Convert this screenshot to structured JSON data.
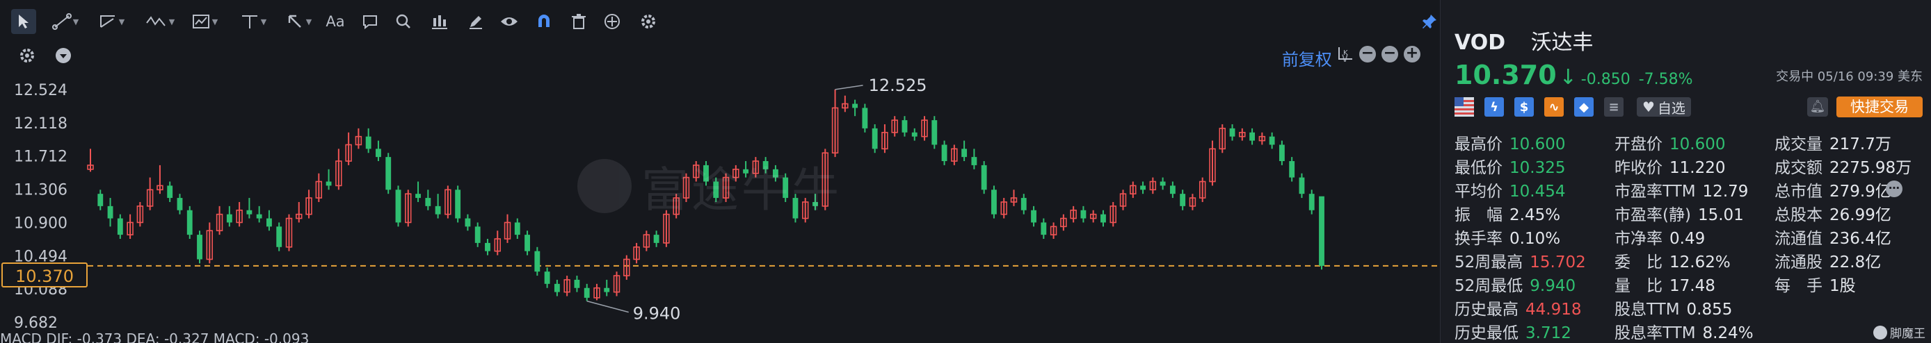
{
  "chart": {
    "adjust_label": "前复权",
    "watermark": "富途牛牛",
    "y_ticks": [
      "12.524",
      "12.118",
      "11.712",
      "11.306",
      "10.900",
      "10.494",
      "10.088",
      "9.682"
    ],
    "current_price_label": "10.370",
    "high_label": "12.525",
    "low_label": "9.940",
    "indicator_text": "MACD  DIF: -0.373  DEA: -0.327  MACD: -0.093",
    "colors": {
      "up": "#f05454",
      "down": "#2fbf71",
      "bg": "#16181d",
      "price_line": "#e8a33a",
      "accent": "#4d8ff7"
    }
  },
  "chart_data": {
    "type": "candlestick",
    "y_axis": {
      "min": 9.682,
      "max": 12.524,
      "ticks": [
        12.524,
        12.118,
        11.712,
        11.306,
        10.9,
        10.494,
        10.088,
        9.682
      ]
    },
    "current_price": 10.37,
    "annotations": [
      {
        "label": "12.525",
        "value": 12.525
      },
      {
        "label": "9.940",
        "value": 9.94
      }
    ],
    "candles": [
      [
        11.55,
        11.6,
        11.52,
        11.8
      ],
      [
        11.25,
        11.1,
        11.05,
        11.3
      ],
      [
        11.1,
        10.95,
        10.85,
        11.2
      ],
      [
        10.95,
        10.75,
        10.7,
        11.0
      ],
      [
        10.75,
        10.9,
        10.7,
        11.0
      ],
      [
        10.9,
        11.1,
        10.85,
        11.15
      ],
      [
        11.1,
        11.3,
        11.05,
        11.45
      ],
      [
        11.3,
        11.35,
        11.25,
        11.6
      ],
      [
        11.35,
        11.2,
        11.15,
        11.4
      ],
      [
        11.2,
        11.05,
        11.0,
        11.25
      ],
      [
        11.05,
        10.75,
        10.7,
        11.1
      ],
      [
        10.75,
        10.45,
        10.4,
        10.8
      ],
      [
        10.45,
        10.8,
        10.4,
        10.9
      ],
      [
        10.8,
        11.0,
        10.75,
        11.1
      ],
      [
        11.0,
        10.9,
        10.85,
        11.1
      ],
      [
        10.9,
        11.05,
        10.85,
        11.15
      ],
      [
        11.05,
        11.0,
        10.95,
        11.2
      ],
      [
        11.0,
        10.95,
        10.9,
        11.1
      ],
      [
        10.95,
        10.85,
        10.8,
        11.05
      ],
      [
        10.85,
        10.6,
        10.55,
        10.9
      ],
      [
        10.6,
        10.95,
        10.55,
        11.0
      ],
      [
        10.95,
        11.0,
        10.9,
        11.15
      ],
      [
        11.0,
        11.2,
        10.95,
        11.3
      ],
      [
        11.2,
        11.4,
        11.15,
        11.5
      ],
      [
        11.4,
        11.35,
        11.3,
        11.55
      ],
      [
        11.35,
        11.65,
        11.3,
        11.8
      ],
      [
        11.65,
        11.85,
        11.6,
        12.0
      ],
      [
        11.85,
        11.95,
        11.8,
        12.05
      ],
      [
        11.95,
        11.8,
        11.75,
        12.05
      ],
      [
        11.8,
        11.7,
        11.65,
        11.9
      ],
      [
        11.7,
        11.3,
        11.25,
        11.75
      ],
      [
        11.3,
        10.9,
        10.85,
        11.35
      ],
      [
        10.9,
        11.25,
        10.85,
        11.3
      ],
      [
        11.25,
        11.2,
        11.15,
        11.4
      ],
      [
        11.2,
        11.1,
        11.05,
        11.3
      ],
      [
        11.1,
        11.0,
        10.95,
        11.25
      ],
      [
        11.0,
        11.3,
        10.95,
        11.35
      ],
      [
        11.3,
        10.95,
        10.9,
        11.35
      ],
      [
        10.95,
        10.85,
        10.8,
        11.0
      ],
      [
        10.85,
        10.65,
        10.6,
        10.9
      ],
      [
        10.65,
        10.55,
        10.5,
        10.7
      ],
      [
        10.55,
        10.7,
        10.5,
        10.8
      ],
      [
        10.7,
        10.9,
        10.65,
        11.0
      ],
      [
        10.9,
        10.75,
        10.7,
        10.95
      ],
      [
        10.75,
        10.55,
        10.5,
        10.8
      ],
      [
        10.55,
        10.3,
        10.25,
        10.6
      ],
      [
        10.3,
        10.15,
        10.1,
        10.35
      ],
      [
        10.15,
        10.05,
        10.0,
        10.2
      ],
      [
        10.05,
        10.2,
        10.0,
        10.25
      ],
      [
        10.2,
        10.1,
        10.05,
        10.25
      ],
      [
        10.1,
        9.98,
        9.94,
        10.15
      ],
      [
        9.98,
        10.1,
        9.95,
        10.15
      ],
      [
        10.1,
        10.05,
        10.0,
        10.2
      ],
      [
        10.05,
        10.25,
        10.0,
        10.3
      ],
      [
        10.25,
        10.45,
        10.2,
        10.5
      ],
      [
        10.45,
        10.6,
        10.4,
        10.65
      ],
      [
        10.6,
        10.75,
        10.55,
        10.8
      ],
      [
        10.75,
        10.65,
        10.6,
        10.8
      ],
      [
        10.65,
        11.0,
        10.6,
        11.05
      ],
      [
        11.0,
        11.2,
        10.95,
        11.25
      ],
      [
        11.2,
        11.45,
        11.15,
        11.5
      ],
      [
        11.45,
        11.6,
        11.4,
        11.65
      ],
      [
        11.6,
        11.4,
        11.35,
        11.65
      ],
      [
        11.4,
        11.2,
        11.15,
        11.45
      ],
      [
        11.2,
        11.45,
        11.15,
        11.5
      ],
      [
        11.45,
        11.55,
        11.4,
        11.6
      ],
      [
        11.55,
        11.5,
        11.45,
        11.65
      ],
      [
        11.5,
        11.65,
        11.45,
        11.7
      ],
      [
        11.65,
        11.55,
        11.5,
        11.7
      ],
      [
        11.55,
        11.45,
        11.4,
        11.6
      ],
      [
        11.45,
        11.2,
        11.15,
        11.5
      ],
      [
        11.2,
        10.95,
        10.9,
        11.25
      ],
      [
        10.95,
        11.15,
        10.9,
        11.2
      ],
      [
        11.15,
        11.1,
        11.05,
        11.25
      ],
      [
        11.1,
        11.75,
        11.05,
        11.8
      ],
      [
        11.75,
        12.3,
        11.7,
        12.525
      ],
      [
        12.3,
        12.35,
        12.25,
        12.45
      ],
      [
        12.35,
        12.3,
        12.2,
        12.4
      ],
      [
        12.3,
        12.05,
        12.0,
        12.35
      ],
      [
        12.05,
        11.8,
        11.75,
        12.1
      ],
      [
        11.8,
        12.0,
        11.75,
        12.1
      ],
      [
        12.0,
        12.15,
        11.95,
        12.2
      ],
      [
        12.15,
        12.0,
        11.95,
        12.2
      ],
      [
        12.0,
        11.95,
        11.9,
        12.05
      ],
      [
        11.95,
        12.15,
        11.9,
        12.2
      ],
      [
        12.15,
        11.85,
        11.8,
        12.2
      ],
      [
        11.85,
        11.65,
        11.6,
        11.9
      ],
      [
        11.65,
        11.8,
        11.6,
        11.85
      ],
      [
        11.8,
        11.7,
        11.65,
        11.9
      ],
      [
        11.7,
        11.6,
        11.55,
        11.8
      ],
      [
        11.6,
        11.3,
        11.25,
        11.65
      ],
      [
        11.3,
        11.0,
        10.95,
        11.35
      ],
      [
        11.0,
        11.15,
        10.95,
        11.2
      ],
      [
        11.15,
        11.2,
        11.1,
        11.3
      ],
      [
        11.2,
        11.05,
        11.0,
        11.25
      ],
      [
        11.05,
        10.9,
        10.85,
        11.1
      ],
      [
        10.9,
        10.75,
        10.7,
        10.95
      ],
      [
        10.75,
        10.85,
        10.7,
        10.9
      ],
      [
        10.85,
        10.95,
        10.8,
        11.0
      ],
      [
        10.95,
        11.05,
        10.9,
        11.1
      ],
      [
        11.05,
        10.95,
        10.9,
        11.1
      ],
      [
        10.95,
        11.0,
        10.9,
        11.05
      ],
      [
        11.0,
        10.9,
        10.85,
        11.05
      ],
      [
        10.9,
        11.1,
        10.85,
        11.15
      ],
      [
        11.1,
        11.25,
        11.05,
        11.3
      ],
      [
        11.25,
        11.35,
        11.2,
        11.4
      ],
      [
        11.35,
        11.3,
        11.25,
        11.4
      ],
      [
        11.3,
        11.4,
        11.25,
        11.45
      ],
      [
        11.4,
        11.35,
        11.3,
        11.45
      ],
      [
        11.35,
        11.25,
        11.2,
        11.4
      ],
      [
        11.25,
        11.1,
        11.05,
        11.3
      ],
      [
        11.1,
        11.2,
        11.05,
        11.25
      ],
      [
        11.2,
        11.4,
        11.15,
        11.45
      ],
      [
        11.4,
        11.8,
        11.35,
        11.9
      ],
      [
        11.8,
        12.05,
        11.75,
        12.1
      ],
      [
        12.05,
        11.95,
        11.9,
        12.1
      ],
      [
        11.95,
        12.0,
        11.9,
        12.05
      ],
      [
        12.0,
        11.9,
        11.85,
        12.05
      ],
      [
        11.9,
        11.95,
        11.85,
        12.0
      ],
      [
        11.95,
        11.85,
        11.8,
        12.0
      ],
      [
        11.85,
        11.65,
        11.6,
        11.9
      ],
      [
        11.65,
        11.45,
        11.4,
        11.7
      ],
      [
        11.45,
        11.25,
        11.2,
        11.5
      ],
      [
        11.25,
        11.05,
        11.0,
        11.3
      ],
      [
        11.22,
        10.37,
        10.325,
        10.6
      ]
    ]
  },
  "quote": {
    "symbol": "VOD",
    "name": "沃达丰",
    "price": "10.370",
    "arrow": "↓",
    "change": "-0.850",
    "change_pct": "-7.58%",
    "status": "交易中 05/16 09:39 美东",
    "watchlist_label": "自选",
    "trade_label": "快捷交易",
    "stats": [
      {
        "label": "最高价",
        "value": "10.600",
        "tone": "down"
      },
      {
        "label": "开盘价",
        "value": "10.600",
        "tone": "down"
      },
      {
        "label": "成交量",
        "value": "217.7万",
        "tone": "neu"
      },
      {
        "label": "最低价",
        "value": "10.325",
        "tone": "down"
      },
      {
        "label": "昨收价",
        "value": "11.220",
        "tone": "neu"
      },
      {
        "label": "成交额",
        "value": "2275.98万",
        "tone": "neu"
      },
      {
        "label": "平均价",
        "value": "10.454",
        "tone": "down"
      },
      {
        "label": "市盈率TTM",
        "value": "12.79",
        "tone": "neu"
      },
      {
        "label": "总市值",
        "value": "279.9亿",
        "tone": "neu"
      },
      {
        "label": "振　幅",
        "value": "2.45%",
        "tone": "neu"
      },
      {
        "label": "市盈率(静)",
        "value": "15.01",
        "tone": "neu"
      },
      {
        "label": "总股本",
        "value": "26.99亿",
        "tone": "neu"
      },
      {
        "label": "换手率",
        "value": "0.10%",
        "tone": "neu"
      },
      {
        "label": "市净率",
        "value": "0.49",
        "tone": "neu"
      },
      {
        "label": "流通值",
        "value": "236.4亿",
        "tone": "neu"
      },
      {
        "label": "52周最高",
        "value": "15.702",
        "tone": "up"
      },
      {
        "label": "委　比",
        "value": "12.62%",
        "tone": "neu"
      },
      {
        "label": "流通股",
        "value": "22.8亿",
        "tone": "neu"
      },
      {
        "label": "52周最低",
        "value": "9.940",
        "tone": "down"
      },
      {
        "label": "量　比",
        "value": "17.48",
        "tone": "neu"
      },
      {
        "label": "每　手",
        "value": "1股",
        "tone": "neu"
      },
      {
        "label": "历史最高",
        "value": "44.918",
        "tone": "up"
      },
      {
        "label": "股息TTM",
        "value": "0.855",
        "tone": "neu"
      },
      {
        "label": "",
        "value": "",
        "tone": "neu"
      },
      {
        "label": "历史最低",
        "value": "3.712",
        "tone": "down"
      },
      {
        "label": "股息率TTM",
        "value": "8.24%",
        "tone": "neu"
      },
      {
        "label": "",
        "value": "",
        "tone": "neu"
      }
    ],
    "brand": "脚魔王"
  }
}
